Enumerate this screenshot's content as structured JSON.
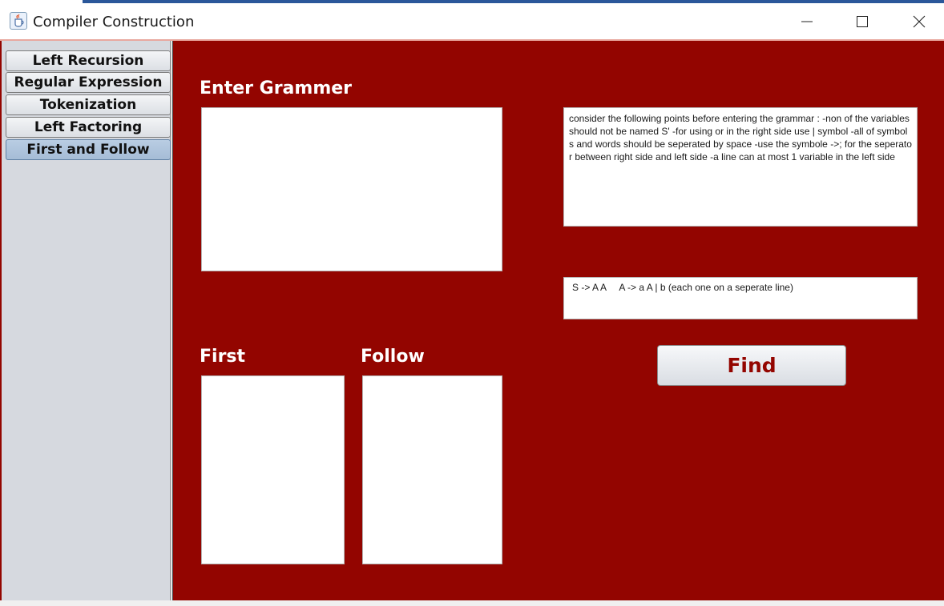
{
  "window": {
    "title": "Compiler Construction",
    "icon": "java-cup-icon"
  },
  "controls": {
    "minimize_icon": "minimize-icon",
    "maximize_icon": "maximize-icon",
    "close_icon": "close-icon"
  },
  "sidebar": {
    "tabs": [
      {
        "label": "Left Recursion",
        "selected": false
      },
      {
        "label": "Regular Expression",
        "selected": false
      },
      {
        "label": "Tokenization",
        "selected": false
      },
      {
        "label": "Left Factoring",
        "selected": false
      },
      {
        "label": "First and Follow",
        "selected": true
      }
    ]
  },
  "main": {
    "grammar_heading": "Enter Grammer",
    "grammar_value": "",
    "instructions": "consider the following points before entering the grammar : -non of the variables should not be named S' -for using or in the right side use | symbol -all of symbols and words should be seperated by space -use the symbole ->; for the seperator between right side and left side -a line can at most 1 variable in the left side",
    "example": "S -> A A     A -> a A | b (each one on a seperate line)",
    "first_heading": "First",
    "first_value": "",
    "follow_heading": "Follow",
    "follow_value": "",
    "find_label": "Find"
  },
  "colors": {
    "background": "#930500",
    "sidebar": "#d6d9df",
    "selected_tab": "#a5bcd6",
    "find_text": "#930500"
  }
}
